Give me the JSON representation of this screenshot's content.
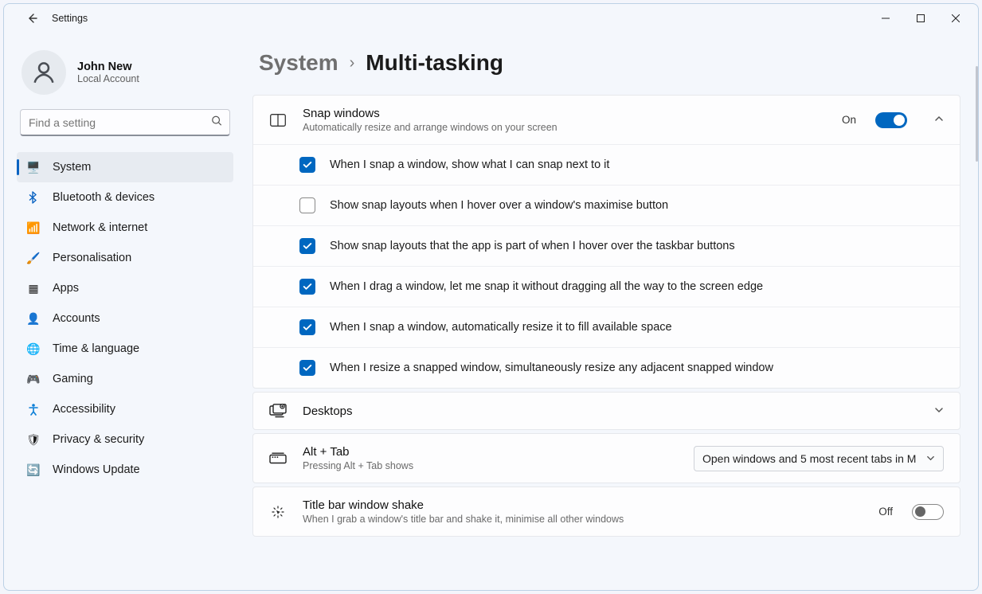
{
  "app_title": "Settings",
  "user": {
    "name": "John New",
    "sub": "Local Account"
  },
  "search": {
    "placeholder": "Find a setting"
  },
  "nav": [
    {
      "label": "System",
      "icon": "🖥️",
      "selected": true
    },
    {
      "label": "Bluetooth & devices",
      "icon": "bt"
    },
    {
      "label": "Network & internet",
      "icon": "📶"
    },
    {
      "label": "Personalisation",
      "icon": "🖌️"
    },
    {
      "label": "Apps",
      "icon": "▦"
    },
    {
      "label": "Accounts",
      "icon": "👤"
    },
    {
      "label": "Time & language",
      "icon": "🌐"
    },
    {
      "label": "Gaming",
      "icon": "🎮"
    },
    {
      "label": "Accessibility",
      "icon": "acc"
    },
    {
      "label": "Privacy & security",
      "icon": "🛡"
    },
    {
      "label": "Windows Update",
      "icon": "🔄"
    }
  ],
  "breadcrumb": {
    "parent": "System",
    "current": "Multi-tasking"
  },
  "snap": {
    "title": "Snap windows",
    "sub": "Automatically resize and arrange windows on your screen",
    "state_label": "On",
    "state": true,
    "options": [
      {
        "checked": true,
        "label": "When I snap a window, show what I can snap next to it"
      },
      {
        "checked": false,
        "label": "Show snap layouts when I hover over a window's maximise button"
      },
      {
        "checked": true,
        "label": "Show snap layouts that the app is part of when I hover over the taskbar buttons"
      },
      {
        "checked": true,
        "label": "When I drag a window, let me snap it without dragging all the way to the screen edge"
      },
      {
        "checked": true,
        "label": "When I snap a window, automatically resize it to fill available space"
      },
      {
        "checked": true,
        "label": "When I resize a snapped window, simultaneously resize any adjacent snapped window"
      }
    ]
  },
  "desktops": {
    "title": "Desktops"
  },
  "alt_tab": {
    "title": "Alt + Tab",
    "sub": "Pressing Alt + Tab shows",
    "value": "Open windows and 5 most recent tabs in M"
  },
  "shake": {
    "title": "Title bar window shake",
    "sub": "When I grab a window's title bar and shake it, minimise all other windows",
    "state_label": "Off",
    "state": false
  }
}
